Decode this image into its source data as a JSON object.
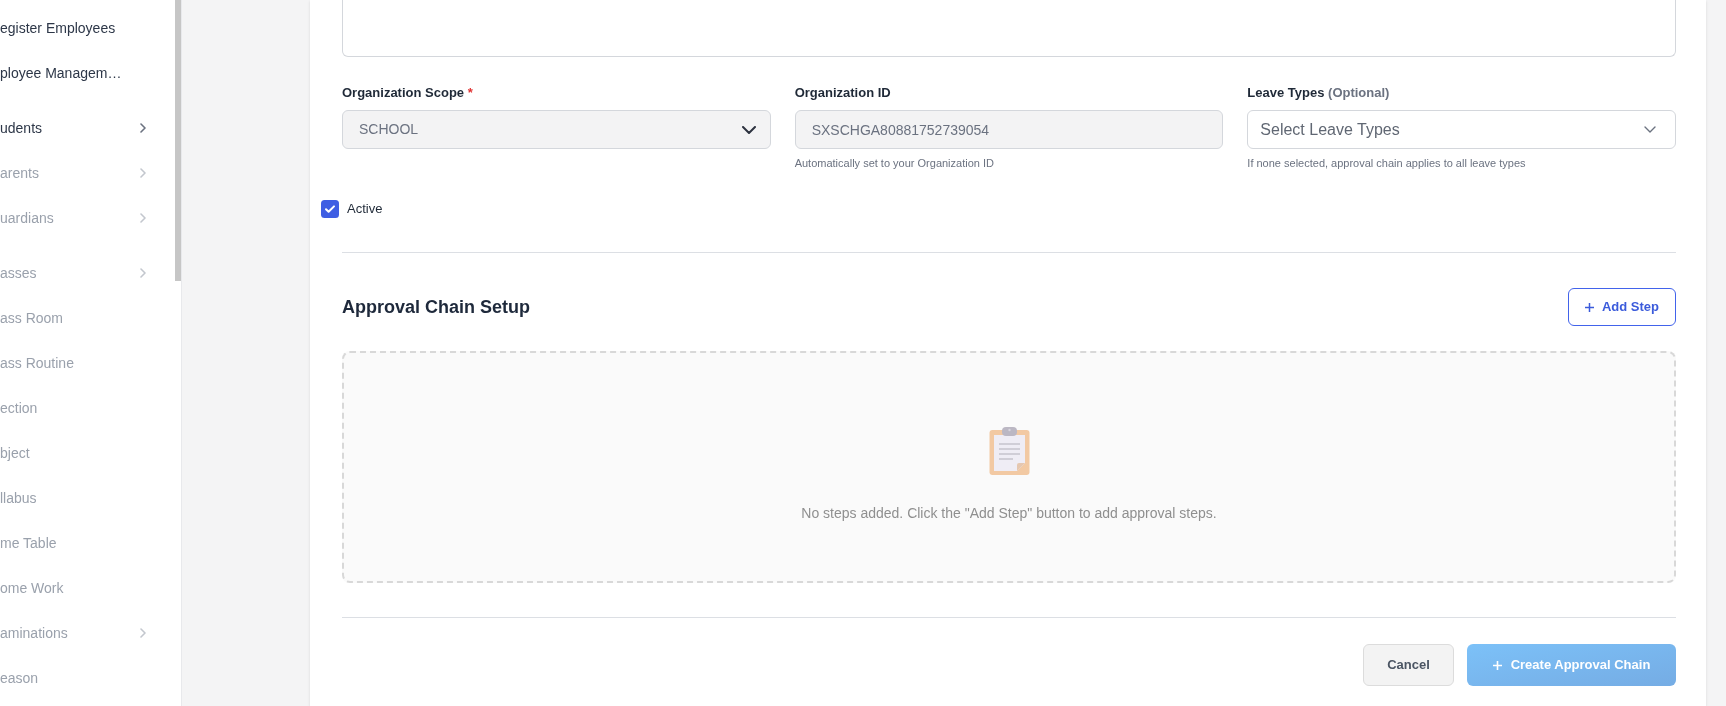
{
  "sidebar": {
    "sections": [
      {
        "items": [
          {
            "label": "egister Employees",
            "disabled": false,
            "has_submenu": false
          },
          {
            "label": "ployee Managem…",
            "disabled": false,
            "has_submenu": false
          }
        ]
      },
      {
        "items": [
          {
            "label": "udents",
            "disabled": false,
            "has_submenu": true
          },
          {
            "label": "arents",
            "disabled": true,
            "has_submenu": true
          },
          {
            "label": "uardians",
            "disabled": true,
            "has_submenu": true
          }
        ]
      },
      {
        "items": [
          {
            "label": "asses",
            "disabled": true,
            "has_submenu": true
          },
          {
            "label": "ass Room",
            "disabled": true,
            "has_submenu": false
          },
          {
            "label": "ass Routine",
            "disabled": true,
            "has_submenu": false
          },
          {
            "label": "ection",
            "disabled": true,
            "has_submenu": false
          },
          {
            "label": "bject",
            "disabled": true,
            "has_submenu": false
          },
          {
            "label": "llabus",
            "disabled": true,
            "has_submenu": false
          },
          {
            "label": "me Table",
            "disabled": true,
            "has_submenu": false
          },
          {
            "label": "ome Work",
            "disabled": true,
            "has_submenu": false
          },
          {
            "label": "aminations",
            "disabled": true,
            "has_submenu": true
          },
          {
            "label": "eason",
            "disabled": true,
            "has_submenu": false
          }
        ]
      }
    ]
  },
  "form": {
    "fields": [
      {
        "kind": "select",
        "label": "Organization Scope",
        "required_mark": "*",
        "value": "SCHOOL",
        "disabled": true
      },
      {
        "kind": "text",
        "label": "Organization ID",
        "value": "SXSCHGA80881752739054",
        "help": "Automatically set to your Organization ID",
        "disabled": true
      },
      {
        "kind": "multiselect",
        "label": "Leave Types",
        "note": "(Optional)",
        "placeholder": "Select Leave Types",
        "help": "If none selected, approval chain applies to all leave types",
        "disabled": false
      }
    ],
    "active": {
      "label": "Active",
      "checked": true
    }
  },
  "approval_chain": {
    "title": "Approval Chain Setup",
    "add_step_button": {
      "label": "Add Step"
    },
    "empty_state": {
      "message": "No steps added. Click the \"Add Step\" button to add approval steps."
    }
  },
  "actions": {
    "cancel_button": {
      "label": "Cancel"
    },
    "create_button": {
      "label": "Create Approval Chain",
      "disabled": true
    }
  }
}
